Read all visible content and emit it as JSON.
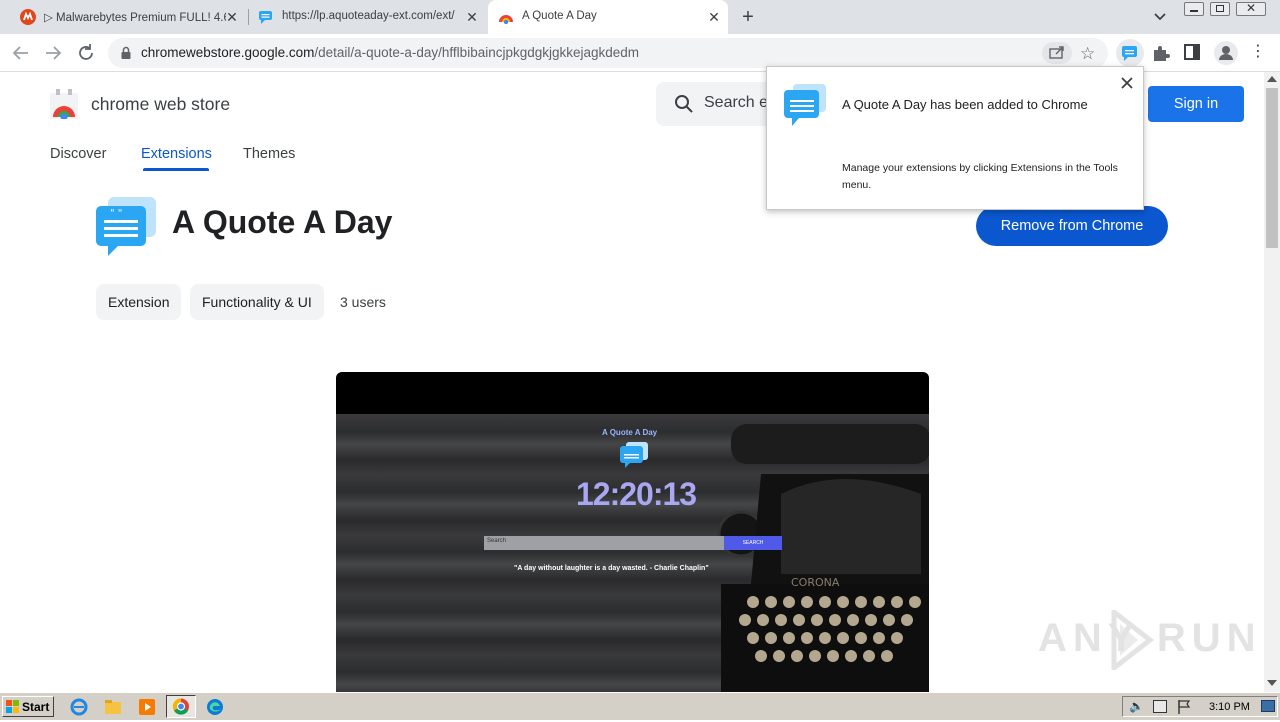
{
  "tabs": [
    {
      "title": "▷ Malwarebytes Premium FULL! 4.6.",
      "icon": "malwarebytes-favicon"
    },
    {
      "title": "https://lp.aquoteaday-ext.com/ext/",
      "icon": "quote-favicon"
    },
    {
      "title": "A Quote A Day",
      "icon": "chrome-store-favicon"
    }
  ],
  "toolbar": {
    "url_domain": "chromewebstore.google.com",
    "url_path": "/detail/a-quote-a-day/hfflbibaincjpkgdgkjgkkejagkdedm"
  },
  "store": {
    "brand": "chrome web store",
    "search_placeholder": "Search e",
    "sign_in": "Sign in",
    "nav": [
      "Discover",
      "Extensions",
      "Themes"
    ]
  },
  "extension": {
    "name": "A Quote A Day",
    "remove_button": "Remove from Chrome",
    "chips": [
      "Extension",
      "Functionality & UI"
    ],
    "users": "3 users"
  },
  "popup": {
    "title": "A Quote A Day has been added to Chrome",
    "body": "Manage your extensions by clicking Extensions in the Tools menu."
  },
  "screenshot": {
    "app_title": "A Quote A Day",
    "clock": "12:20:13",
    "search_placeholder": "Search",
    "search_button": "SEARCH",
    "quote": "\"A day without laughter is a day wasted. - Charlie Chaplin\"",
    "typewriter_brand": "CORONA"
  },
  "watermark": "ANY RUN",
  "taskbar": {
    "start": "Start",
    "clock": "3:10 PM"
  },
  "colors": {
    "accent_blue": "#0b57d0",
    "sign_in_blue": "#1a73e8",
    "tab_strip": "#dee1e6"
  }
}
